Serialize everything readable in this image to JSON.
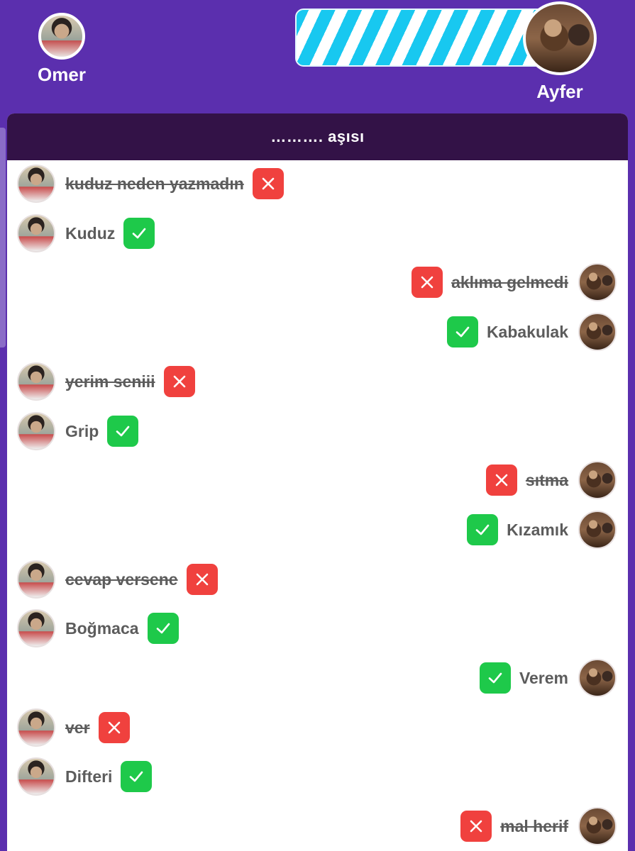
{
  "players": {
    "left": {
      "name": "Omer"
    },
    "right": {
      "name": "Ayfer"
    }
  },
  "progress": {
    "filled_fraction": 0.86,
    "stripe_color": "#18c8f0"
  },
  "card": {
    "title": "………. aşısı"
  },
  "colors": {
    "background": "#5b2fae",
    "header": "#331247",
    "wrong": "#f0413e",
    "correct": "#1ec94a"
  },
  "messages": [
    {
      "side": "left",
      "text": "kuduz neden yazmadın",
      "status": "wrong"
    },
    {
      "side": "left",
      "text": "Kuduz",
      "status": "correct"
    },
    {
      "side": "right",
      "text": "aklıma gelmedi",
      "status": "wrong"
    },
    {
      "side": "right",
      "text": "Kabakulak",
      "status": "correct"
    },
    {
      "side": "left",
      "text": "yerim seniii",
      "status": "wrong"
    },
    {
      "side": "left",
      "text": "Grip",
      "status": "correct"
    },
    {
      "side": "right",
      "text": "sıtma",
      "status": "wrong"
    },
    {
      "side": "right",
      "text": "Kızamık",
      "status": "correct"
    },
    {
      "side": "left",
      "text": "cevap versene",
      "status": "wrong"
    },
    {
      "side": "left",
      "text": "Boğmaca",
      "status": "correct"
    },
    {
      "side": "right",
      "text": "Verem",
      "status": "correct"
    },
    {
      "side": "left",
      "text": "ver",
      "status": "wrong"
    },
    {
      "side": "left",
      "text": "Difteri",
      "status": "correct"
    },
    {
      "side": "right",
      "text": "mal herif",
      "status": "wrong"
    }
  ]
}
